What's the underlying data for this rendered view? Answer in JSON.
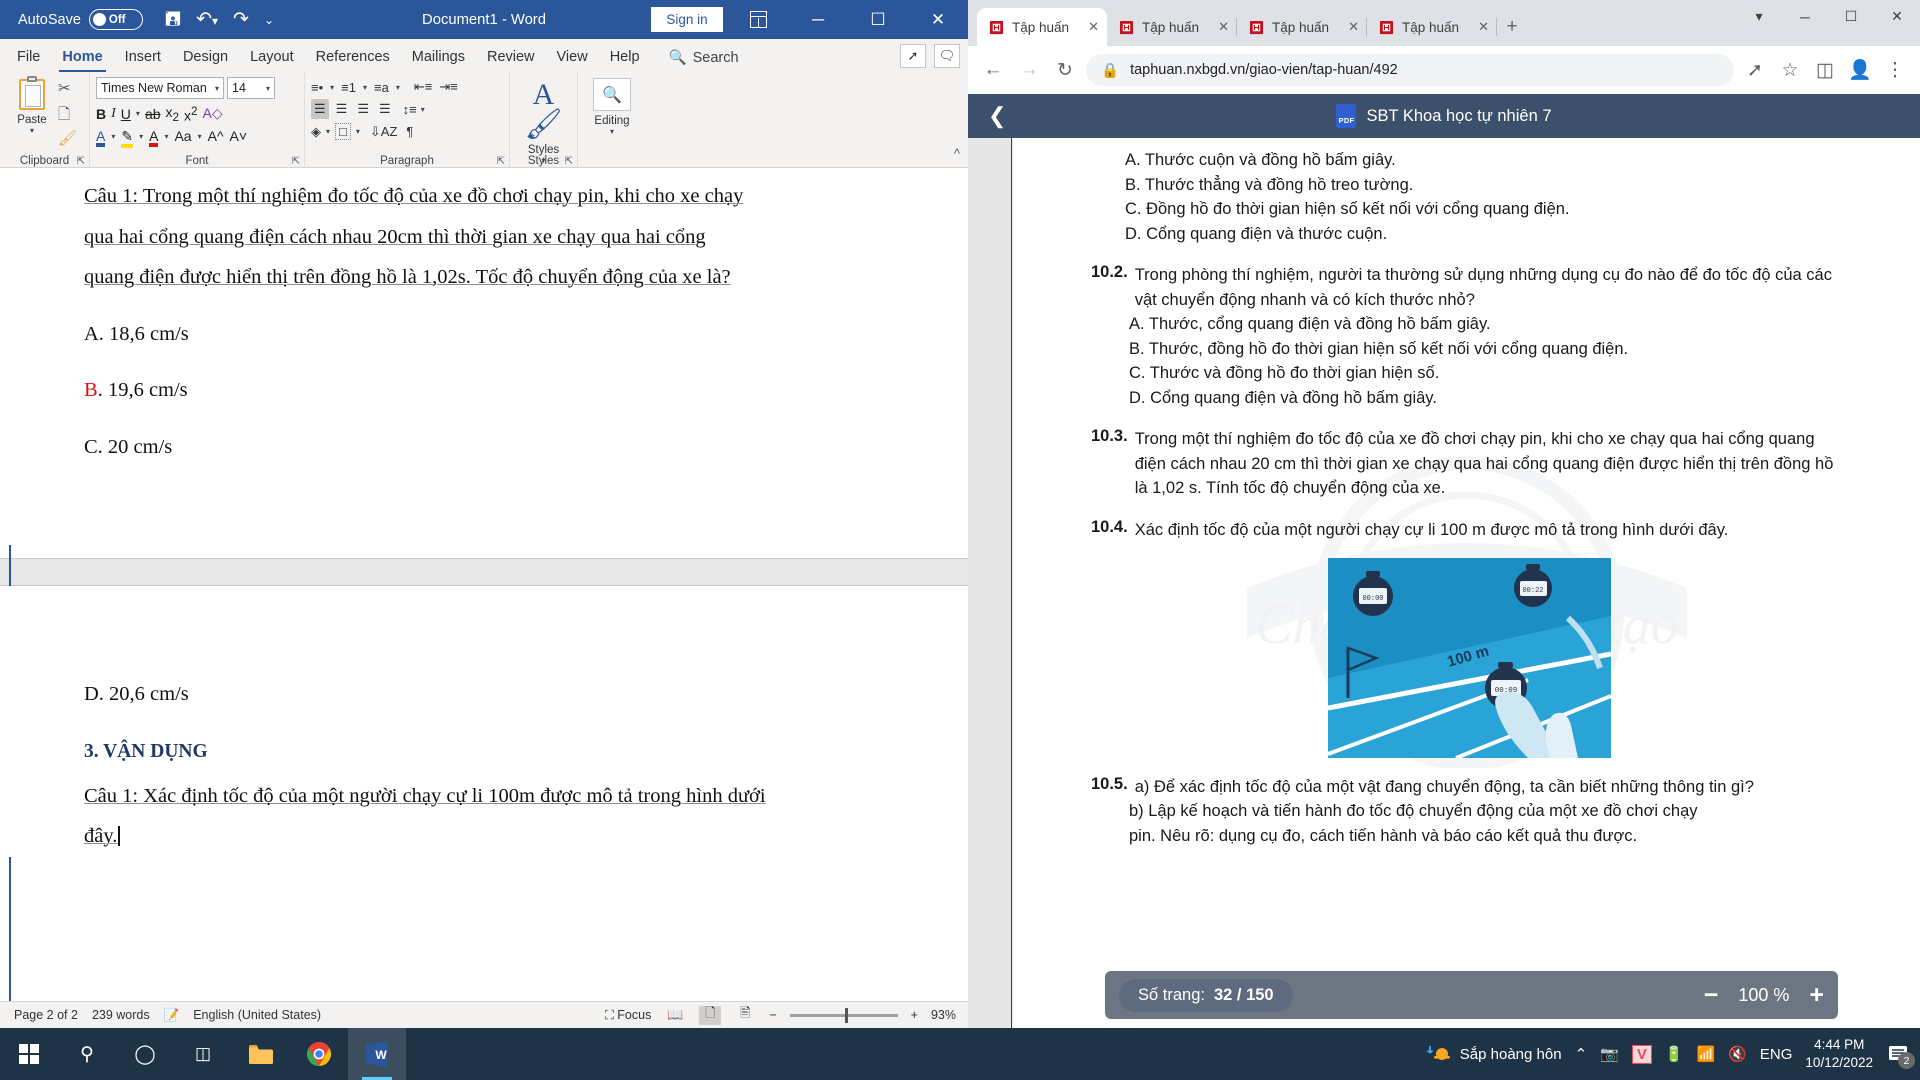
{
  "word": {
    "titlebar": {
      "autosave_label": "AutoSave",
      "autosave_state": "Off",
      "save_icon": "save-icon",
      "undo_icon": "undo-icon",
      "redo_icon": "redo-icon",
      "customize_icon": "customize-quick-access-icon",
      "document_title": "Document1  -  Word",
      "sign_in": "Sign in",
      "minimize": "─",
      "maximize": "☐",
      "close": "✕"
    },
    "tabs": [
      {
        "label": "File",
        "active": false
      },
      {
        "label": "Home",
        "active": true
      },
      {
        "label": "Insert",
        "active": false
      },
      {
        "label": "Design",
        "active": false
      },
      {
        "label": "Layout",
        "active": false
      },
      {
        "label": "References",
        "active": false
      },
      {
        "label": "Mailings",
        "active": false
      },
      {
        "label": "Review",
        "active": false
      },
      {
        "label": "View",
        "active": false
      },
      {
        "label": "Help",
        "active": false
      }
    ],
    "search_placeholder": "Search",
    "ribbon": {
      "clipboard_group": "Clipboard",
      "paste_label": "Paste",
      "font_group": "Font",
      "font_name": "Times New Roman",
      "font_size": "14",
      "paragraph_group": "Paragraph",
      "styles_group": "Styles",
      "styles_label": "Styles",
      "editing_label": "Editing"
    },
    "document": {
      "page1": [
        {
          "text": "Câu 1: Trong một thí nghiệm đo tốc độ của xe đồ chơi chạy pin, khi cho xe chạy"
        },
        {
          "text": "qua hai cổng  quang điện cách nhau 20cm  thì thời gian xe chạy qua hai cổng"
        },
        {
          "text": "quang điện được hiển thị trên đồng hồ là 1,02s. Tốc độ chuyển động của xe là?"
        },
        {
          "text": "A. 18,6 cm/s"
        },
        {
          "text": "B. 19,6 cm/s",
          "red_prefix": "B"
        },
        {
          "text": "C. 20 cm/s"
        }
      ],
      "page2": [
        {
          "text": "D. 20,6 cm/s"
        },
        {
          "text": "3. VẬN DỤNG",
          "heading": true
        },
        {
          "text": "Câu 1: Xác định tốc độ của một người chạy cự li 100m được mô tả trong hình dưới"
        },
        {
          "text": "đây."
        }
      ]
    },
    "status": {
      "page": "Page 2 of 2",
      "words": "239 words",
      "proofing_icon": "proofing-errors-icon",
      "language": "English (United States)",
      "focus": "Focus",
      "read_mode_icon": "read-mode-icon",
      "print_layout_icon": "print-layout-icon",
      "web_layout_icon": "web-layout-icon",
      "zoom_out": "−",
      "zoom_in": "+",
      "zoom": "93%"
    }
  },
  "chrome": {
    "tabs": [
      {
        "label": "Tập huấn",
        "active": true
      },
      {
        "label": "Tập huấn",
        "active": false
      },
      {
        "label": "Tập huấn",
        "active": false
      },
      {
        "label": "Tập huấn",
        "active": false
      }
    ],
    "new_tab": "+",
    "window_controls": {
      "minimize": "─",
      "maximize": "☐",
      "close": "✕"
    },
    "toolbar": {
      "back_icon": "back-arrow-icon",
      "forward_icon": "forward-arrow-icon",
      "reload_icon": "reload-icon",
      "lock_icon": "lock-icon",
      "url": "taphuan.nxbgd.vn/giao-vien/tap-huan/492",
      "share_icon": "share-icon",
      "bookmark_icon": "star-icon",
      "sidepanel_icon": "side-panel-icon",
      "profile_icon": "profile-avatar-icon",
      "menu_icon": "three-dot-menu-icon"
    }
  },
  "pdf_viewer": {
    "back_icon": "chevron-left-icon",
    "badge": "PDF",
    "title": "SBT Khoa học tự nhiên 7",
    "page_label": "Số trang:",
    "page_value": "32 / 150",
    "zoom_out": "−",
    "zoom_value": "100 %",
    "zoom_in": "+",
    "content": {
      "top_options": [
        "A. Thước cuộn và đồng hồ bấm giây.",
        "B. Thước thẳng và đồng hồ treo tường.",
        "C. Đồng hồ đo thời gian hiện số kết nối với cổng quang điện.",
        "D. Cổng quang điện và thước cuộn."
      ],
      "questions": [
        {
          "num": "10.2.",
          "text": "Trong phòng thí nghiệm, người ta thường sử dụng những dụng cụ đo nào để đo tốc độ của các vật chuyển động nhanh và có kích thước nhỏ?",
          "options": [
            "A. Thước, cổng quang điện và đồng hồ bấm giây.",
            "B. Thước, đồng hồ đo thời gian hiện số kết nối với cổng quang điện.",
            "C. Thước và đồng hồ đo thời gian hiện số.",
            "D. Cổng quang điện và đồng hồ bấm giây."
          ]
        },
        {
          "num": "10.3.",
          "text": "Trong một thí nghiệm đo tốc độ của xe đồ chơi chạy pin, khi cho xe chạy qua hai cổng quang điện cách nhau 20 cm thì thời gian xe chạy qua hai cổng quang điện được hiển thị trên đồng hồ là 1,02 s. Tính tốc độ chuyển động của xe.",
          "options": []
        },
        {
          "num": "10.4.",
          "text": "Xác định tốc độ của một người chạy cự li 100 m được mô tả trong hình dưới đây.",
          "options": []
        },
        {
          "num": "10.5.",
          "text": "a) Để xác định tốc độ của một vật đang chuyển động, ta cần biết những thông tin gì?",
          "options": []
        }
      ],
      "obscured_lines": [
        "b) Lập kế hoạch và tiến hành đo tốc độ chuyển động của một xe đồ chơi chạy",
        "pin. Nêu rõ: dụng cụ đo, cách tiến hành và báo cáo kết quả thu được."
      ],
      "figure": {
        "distance_label": "100 m",
        "stopwatch_1": "00:00:00",
        "stopwatch_2": "00:22:00",
        "stopwatch_3": "00:09:58"
      },
      "watermark": "Chân trời sáng tạo"
    }
  },
  "taskbar": {
    "start_icon": "windows-start-icon",
    "search_icon": "search-icon",
    "cortana_icon": "cortana-icon",
    "taskview_icon": "task-view-icon",
    "explorer_icon": "file-explorer-icon",
    "chrome_icon": "chrome-icon",
    "word_icon": "word-icon",
    "weather_text": "Sắp hoàng hôn",
    "tray_expand": "⌃",
    "camera_icon": "camera-icon",
    "antivirus_icon": "antivirus-icon",
    "battery_icon": "battery-charging-icon",
    "network_icon": "wifi-icon",
    "volume_icon": "volume-muted-icon",
    "language": "ENG",
    "time": "4:44 PM",
    "date": "10/12/2022",
    "notification_count": "2"
  }
}
